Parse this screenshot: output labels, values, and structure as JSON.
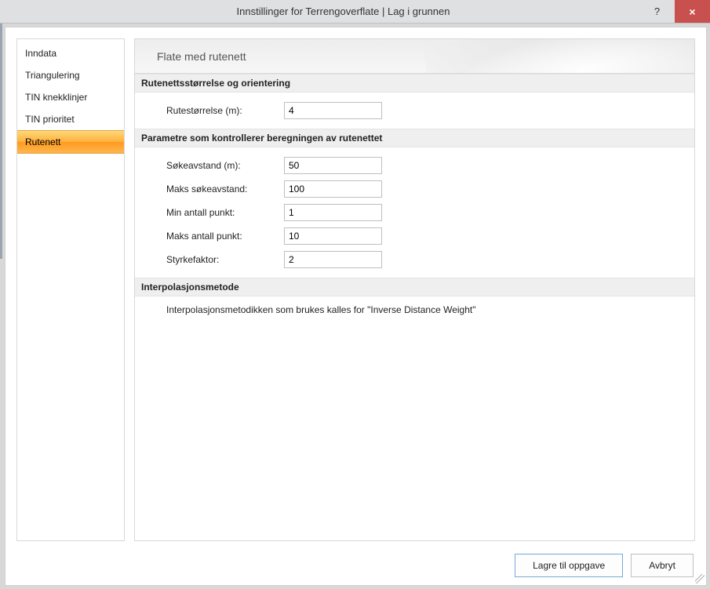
{
  "titlebar": {
    "title": "Innstillinger for Terrengoverflate  |  Lag i grunnen",
    "help": "?",
    "close": "×"
  },
  "sidebar": {
    "items": [
      {
        "label": "Inndata"
      },
      {
        "label": "Triangulering"
      },
      {
        "label": "TIN knekklinjer"
      },
      {
        "label": "TIN prioritet"
      },
      {
        "label": "Rutenett"
      }
    ]
  },
  "main": {
    "header": "Flate med rutenett",
    "section1": {
      "title": "Rutenettsstørrelse og orientering",
      "row1": {
        "label": "Rutestørrelse (m):",
        "value": "4"
      }
    },
    "section2": {
      "title": "Parametre som kontrollerer beregningen av rutenettet",
      "row1": {
        "label": "Søkeavstand (m):",
        "value": "50"
      },
      "row2": {
        "label": "Maks søkeavstand:",
        "value": "100"
      },
      "row3": {
        "label": "Min antall punkt:",
        "value": "1"
      },
      "row4": {
        "label": "Maks antall punkt:",
        "value": "10"
      },
      "row5": {
        "label": "Styrkefaktor:",
        "value": "2"
      }
    },
    "section3": {
      "title": "Interpolasjonsmetode",
      "text": "Interpolasjonsmetodikken som brukes kalles for \"Inverse Distance Weight\""
    }
  },
  "footer": {
    "save": "Lagre til oppgave",
    "cancel": "Avbryt"
  }
}
